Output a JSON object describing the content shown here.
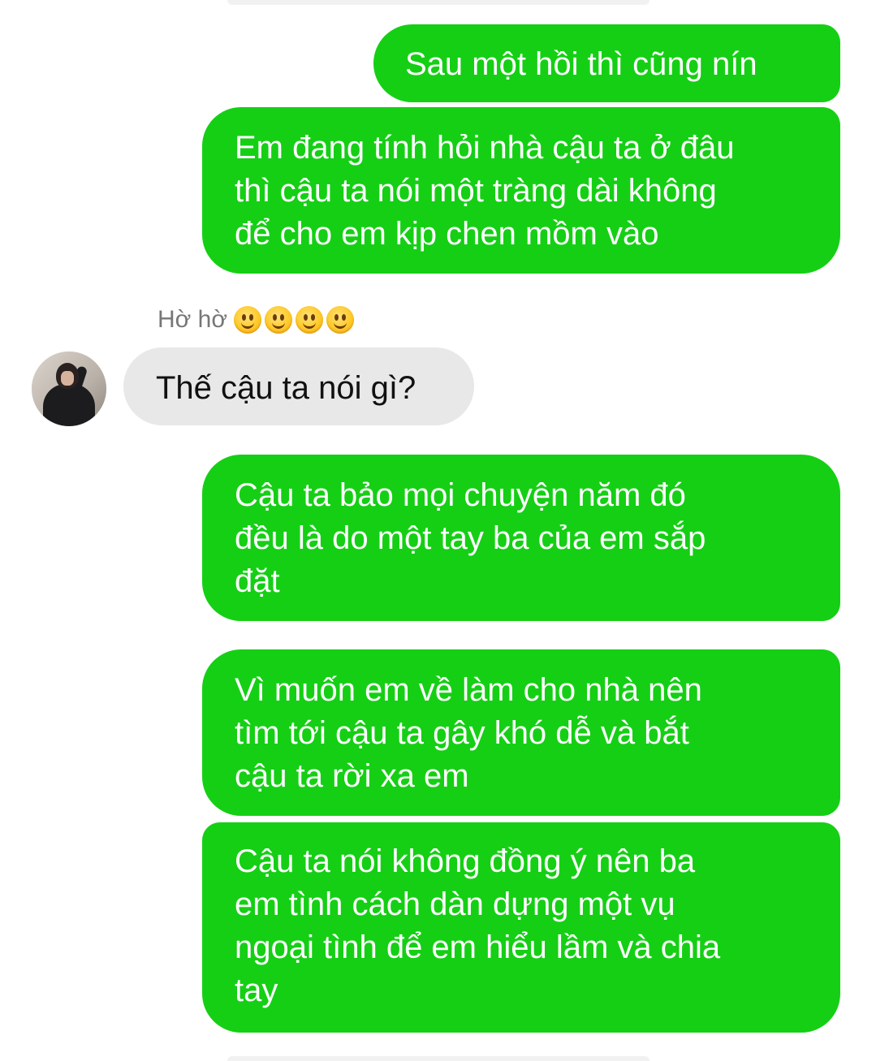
{
  "thread": {
    "messages": [
      {
        "direction": "outgoing",
        "text": "Sau một hồi thì cũng nín"
      },
      {
        "direction": "outgoing",
        "text": "Em đang tính hỏi nhà cậu ta ở đâu\nthì cậu ta nói một tràng dài không\nđể cho em kịp chen mồm vào"
      },
      {
        "direction": "incoming",
        "text": "Thế cậu ta nói gì?"
      },
      {
        "direction": "outgoing",
        "text": "Cậu ta bảo mọi chuyện năm đó\nđều là do một tay ba của em sắp\nđặt"
      },
      {
        "direction": "outgoing",
        "text": "Vì muốn em về làm cho nhà nên\ntìm tới cậu ta gây khó dễ và bắt\ncậu ta rời xa em"
      },
      {
        "direction": "outgoing",
        "text": "Cậu ta nói không đồng ý nên ba\nem tình cách dàn dựng một vụ\nngoại tình để em hiểu lầm và chia\ntay"
      }
    ],
    "reply_preview": {
      "text": "Hờ hờ",
      "emoji_icons": [
        "slightly-smiling-face-icon",
        "slightly-smiling-face-icon",
        "slightly-smiling-face-icon",
        "slightly-smiling-face-icon"
      ]
    },
    "colors": {
      "outgoing_bubble": "#15cf15",
      "incoming_bubble": "#e8e8e8",
      "outgoing_text": "#ffffff",
      "incoming_text": "#111111"
    }
  }
}
